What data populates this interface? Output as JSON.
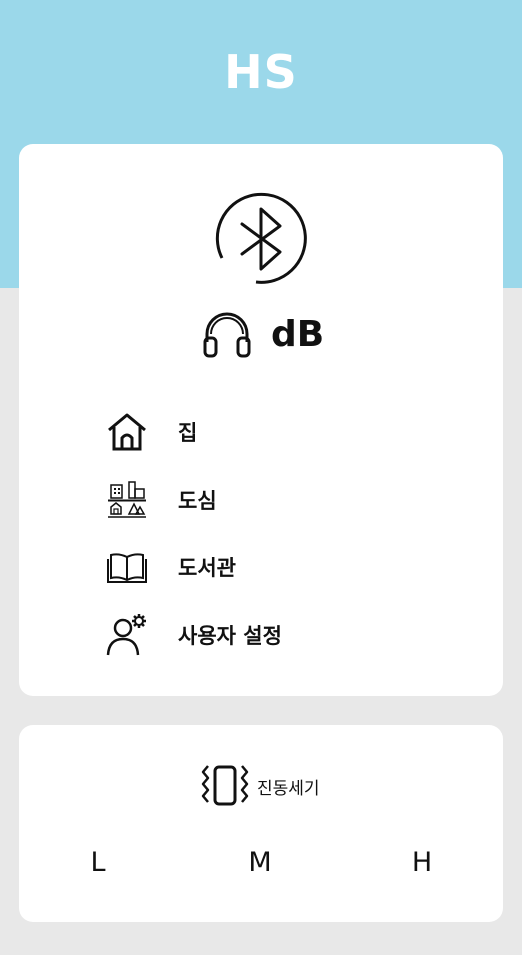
{
  "header": {
    "title": "HS",
    "background": "#9bd8ea"
  },
  "main_card": {
    "bluetooth_icon": "bluetooth-icon",
    "headphones_icon": "headphones-icon",
    "db_label": "dB",
    "menu": [
      {
        "label": "집",
        "icon": "home-icon"
      },
      {
        "label": "도심",
        "icon": "city-icon"
      },
      {
        "label": "도서관",
        "icon": "book-icon"
      },
      {
        "label": "사용자 설정",
        "icon": "user-settings-icon"
      }
    ]
  },
  "vibration_card": {
    "icon": "phone-vibrate-icon",
    "label": "진동세기",
    "levels": [
      "L",
      "M",
      "H"
    ]
  }
}
